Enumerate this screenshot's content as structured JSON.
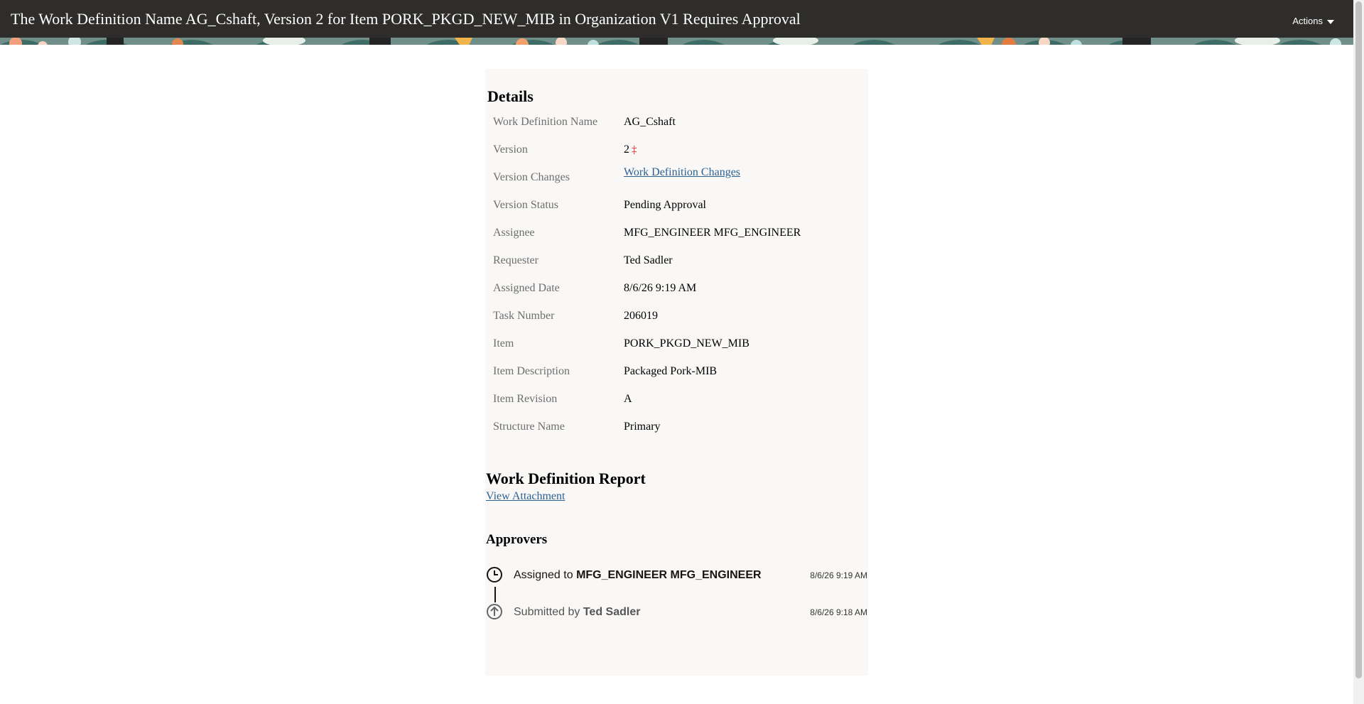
{
  "header": {
    "title": "The Work Definition Name AG_Cshaft, Version 2 for Item PORK_PKGD_NEW_MIB in Organization V1 Requires Approval",
    "actions_label": "Actions"
  },
  "details": {
    "heading": "Details",
    "rows": [
      {
        "label": "Work Definition Name",
        "value": "AG_Cshaft"
      },
      {
        "label": "Version",
        "value": "2",
        "marker": "‡"
      },
      {
        "label": "Version Changes",
        "value": "Work Definition Changes"
      },
      {
        "label": "Version Status",
        "value": "Pending Approval"
      },
      {
        "label": "Assignee",
        "value": "MFG_ENGINEER MFG_ENGINEER"
      },
      {
        "label": "Requester",
        "value": "Ted Sadler"
      },
      {
        "label": "Assigned Date",
        "value": "8/6/26 9:19 AM"
      },
      {
        "label": "Task Number",
        "value": "206019"
      },
      {
        "label": "Item",
        "value": "PORK_PKGD_NEW_MIB"
      },
      {
        "label": "Item Description",
        "value": "Packaged Pork-MIB"
      },
      {
        "label": "Item Revision",
        "value": "A"
      },
      {
        "label": "Structure Name",
        "value": "Primary"
      }
    ]
  },
  "report": {
    "heading": "Work Definition Report",
    "link": "View Attachment"
  },
  "approvers": {
    "heading": "Approvers",
    "items": [
      {
        "prefix": "Assigned to",
        "name": "MFG_ENGINEER MFG_ENGINEER",
        "time": "8/6/26 9:19 AM",
        "icon": "clock-icon"
      },
      {
        "prefix": "Submitted by",
        "name": "Ted Sadler",
        "time": "8/6/26 9:18 AM",
        "icon": "arrow-up-circle-icon"
      }
    ]
  },
  "colors": {
    "header_bg": "#2e2d2b",
    "card_bg": "#f9f8f6",
    "link": "#2b6293",
    "marker": "#d21a1a"
  }
}
